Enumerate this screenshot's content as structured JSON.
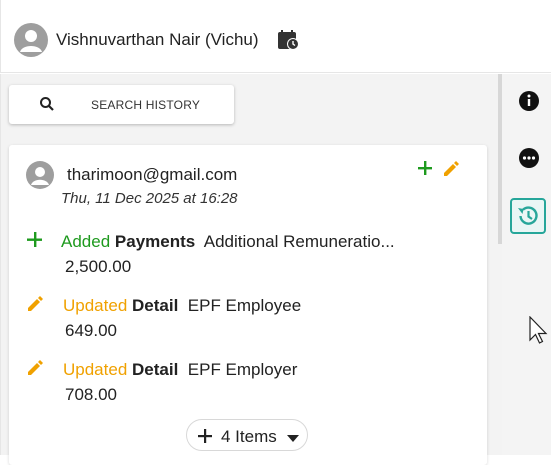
{
  "header": {
    "user_name": "Vishnuvarthan Nair (Vichu)",
    "avatar_icon": "person-avatar-icon",
    "calendar_icon": "calendar-clock-icon"
  },
  "search": {
    "label": "SEARCH HISTORY",
    "icon": "search-icon"
  },
  "history_card": {
    "author_email": "tharimoon@gmail.com",
    "timestamp": "Thu, 11 Dec 2025 at 16:28",
    "summary_icons": [
      "plus-icon",
      "pencil-icon"
    ],
    "entries": [
      {
        "icon": "plus-icon",
        "action": "Added",
        "field": "Payments",
        "description": "Additional Remuneratio...",
        "value": "2,500.00"
      },
      {
        "icon": "pencil-icon",
        "action": "Updated",
        "field": "Detail",
        "description": "EPF Employee",
        "value": "649.00"
      },
      {
        "icon": "pencil-icon",
        "action": "Updated",
        "field": "Detail",
        "description": "EPF Employer",
        "value": "708.00"
      }
    ],
    "more_button": {
      "label": "4 Items",
      "icon": "plus-icon",
      "caret": "caret-down-icon"
    }
  },
  "rail": {
    "items": [
      {
        "icon": "info-icon",
        "active": false
      },
      {
        "icon": "more-horizontal-icon",
        "active": false
      },
      {
        "icon": "history-icon",
        "active": true
      }
    ]
  },
  "colors": {
    "added": "#1e9a1e",
    "updated": "#f0a100",
    "accent": "#26a69a",
    "avatar_gray": "#9e9e9e"
  }
}
